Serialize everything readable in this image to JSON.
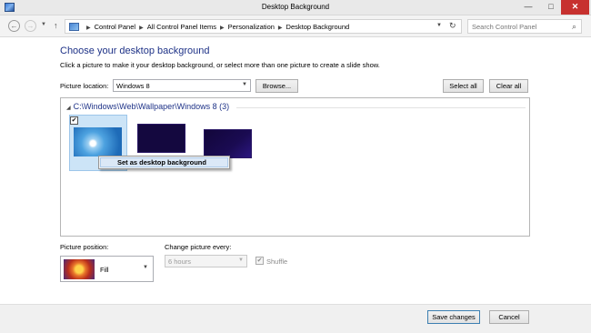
{
  "window": {
    "title": "Desktop Background",
    "min_glyph": "—",
    "max_glyph": "□",
    "close_glyph": "✕"
  },
  "nav": {
    "back_glyph": "←",
    "forward_glyph": "→",
    "dropdown_glyph": "▼",
    "up_glyph": "↑",
    "breadcrumbs": [
      "Control Panel",
      "All Control Panel Items",
      "Personalization",
      "Desktop Background"
    ],
    "search_placeholder": "Search Control Panel"
  },
  "main": {
    "heading": "Choose your desktop background",
    "subtitle": "Click a picture to make it your desktop background, or select more than one picture to create a slide show.",
    "picture_location_label": "Picture location:",
    "picture_location_value": "Windows 8",
    "browse_label": "Browse...",
    "select_all_label": "Select all",
    "clear_all_label": "Clear all"
  },
  "gallery": {
    "group_header": "C:\\Windows\\Web\\Wallpaper\\Windows 8 (3)",
    "checked_mark": "✔",
    "images": [
      {
        "name": "wallpaper-flower",
        "checked": true
      },
      {
        "name": "wallpaper-dark-1",
        "checked": false
      },
      {
        "name": "wallpaper-dark-2",
        "checked": false
      }
    ]
  },
  "context_menu": {
    "items": [
      "Set as desktop background"
    ]
  },
  "options": {
    "picture_position_label": "Picture position:",
    "picture_position_value": "Fill",
    "change_every_label": "Change picture every:",
    "change_every_value": "6 hours",
    "shuffle_label": "Shuffle",
    "shuffle_checked": true
  },
  "footer": {
    "save_label": "Save changes",
    "cancel_label": "Cancel"
  },
  "colors": {
    "heading": "#1e3287",
    "close_button": "#c7312f",
    "selection": "#cce4f7"
  }
}
